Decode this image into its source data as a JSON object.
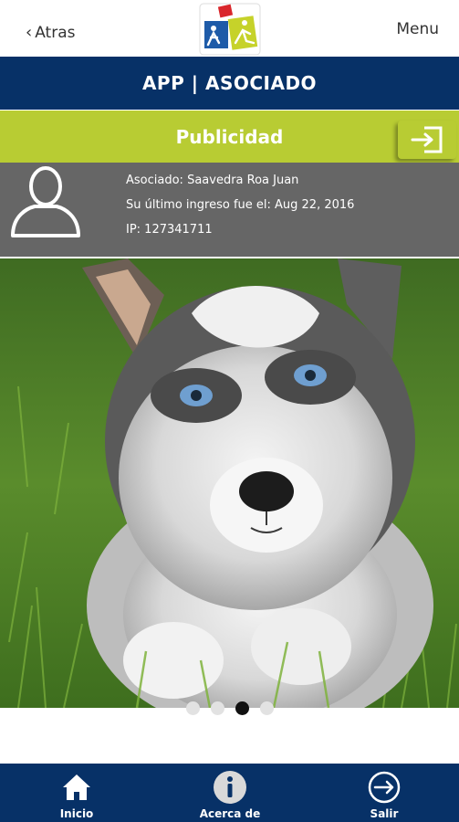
{
  "header": {
    "back_label": "Atras",
    "menu_label": "Menu"
  },
  "title_bar": {
    "title": "APP | ASOCIADO"
  },
  "ad_bar": {
    "label": "Publicidad"
  },
  "user": {
    "associate": "Asociado: Saavedra Roa Juan",
    "last_login": "Su último ingreso fue el: Aug 22, 2016",
    "ip": "IP: 127341711"
  },
  "carousel": {
    "slide_count": 4,
    "active_index": 2
  },
  "footer": {
    "items": [
      {
        "label": "Inicio",
        "icon": "home-icon"
      },
      {
        "label": "Acerca de",
        "icon": "info-icon"
      },
      {
        "label": "Salir",
        "icon": "logout-icon"
      }
    ]
  },
  "colors": {
    "primary": "#073167",
    "accent": "#b8cc33",
    "user_bar": "#666666"
  }
}
